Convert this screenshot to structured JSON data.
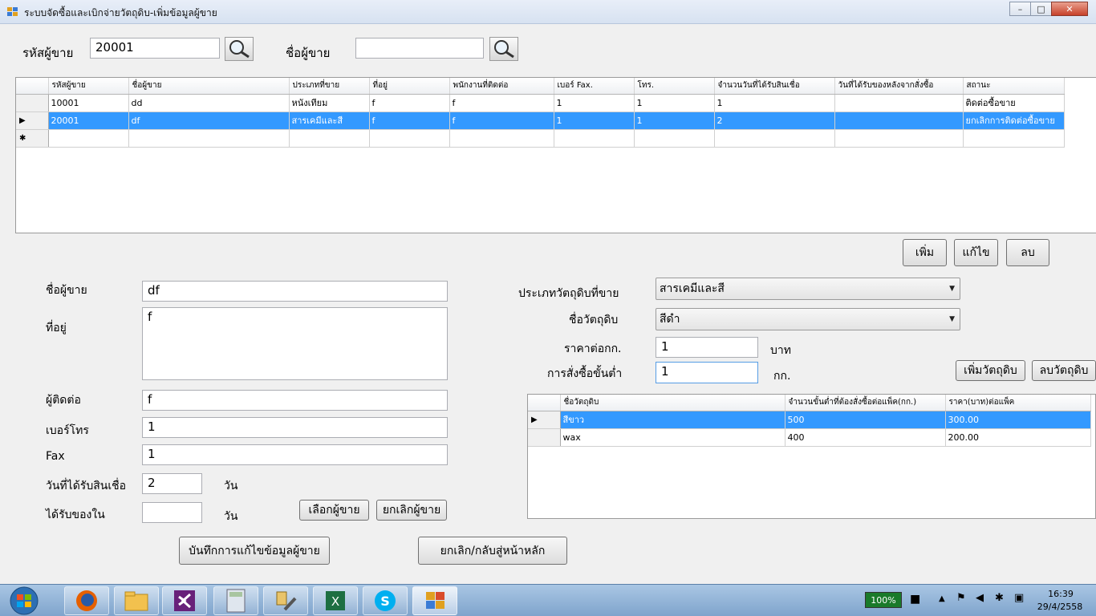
{
  "window": {
    "title": "ระบบจัดซื้อและเบิกจ่ายวัตถุดิบ-เพิ่มข้อมูลผู้ขาย",
    "minimize": "–",
    "maximize": "□",
    "close": "✕"
  },
  "search": {
    "code_label": "รหัสผู้ขาย",
    "code_value": "20001",
    "name_label": "ชื่อผู้ขาย",
    "name_value": ""
  },
  "supplier_grid": {
    "columns": [
      "รหัสผู้ขาย",
      "ชื่อผู้ขาย",
      "ประเภทที่ขาย",
      "ที่อยู่",
      "พนักงานที่ติดต่อ",
      "เบอร์ Fax.",
      "โทร.",
      "จำนวนวันที่ได้รับสินเชื่อ",
      "วันที่ได้รับของหลังจากสั่งซื้อ",
      "สถานะ"
    ],
    "rows": [
      {
        "marker": "",
        "cells": [
          "10001",
          "dd",
          "หนังเทียม",
          "f",
          "f",
          "1",
          "1",
          "1",
          "",
          "ติดต่อซื้อขาย"
        ]
      },
      {
        "marker": "▶",
        "cells": [
          "20001",
          "df",
          "สารเคมีและสี",
          "f",
          "f",
          "1",
          "1",
          "2",
          "",
          "ยกเลิกการติดต่อซื้อขาย"
        ]
      },
      {
        "marker": "✱",
        "cells": [
          "",
          "",
          "",
          "",
          "",
          "",
          "",
          "",
          "",
          ""
        ]
      }
    ],
    "selected_row": 1
  },
  "actions": {
    "add": "เพิ่ม",
    "edit": "แก้ไข",
    "delete": "ลบ"
  },
  "form": {
    "name_label": "ชื่อผู้ขาย",
    "name_value": "df",
    "address_label": "ที่อยู่",
    "address_value": "f",
    "contact_label": "ผู้ติดต่อ",
    "contact_value": "f",
    "phone_label": "เบอร์โทร",
    "phone_value": "1",
    "fax_label": "Fax",
    "fax_value": "1",
    "credit_label": "วันที่ได้รับสินเชื่อ",
    "credit_value": "2",
    "credit_unit": "วัน",
    "receive_label": "ได้รับของใน",
    "receive_value": "",
    "receive_unit": "วัน",
    "select_supplier": "เลือกผู้ขาย",
    "cancel_supplier": "ยกเลิกผู้ขาย",
    "save": "บันทึกการแก้ไขข้อมูลผู้ขาย",
    "back": "ยกเลิก/กลับสู่หน้าหลัก"
  },
  "material": {
    "type_label": "ประเภทวัตถุดิบที่ขาย",
    "type_value": "สารเคมีและสี",
    "name_label": "ชื่อวัตถุดิบ",
    "name_value": "สีดำ",
    "price_label": "ราคาต่อกก.",
    "price_value": "1",
    "price_unit": "บาท",
    "min_label": "การสั่งซื้อขั้นต่ำ",
    "min_value": "1",
    "min_unit": "กก.",
    "add_btn": "เพิ่มวัตถุดิบ",
    "del_btn": "ลบวัตถุดิบ"
  },
  "material_grid": {
    "columns": [
      "ชื่อวัตถุดิบ",
      "จำนวนขั้นต่ำที่ต้องสั่งซื้อต่อแพ็ค(กก.)",
      "ราคา(บาท)ต่อแพ็ค"
    ],
    "rows": [
      {
        "marker": "▶",
        "cells": [
          "สีขาว",
          "500",
          "300.00"
        ]
      },
      {
        "marker": "",
        "cells": [
          "wax",
          "400",
          "200.00"
        ]
      }
    ]
  },
  "taskbar": {
    "battery": "100%",
    "time": "16:39",
    "date": "29/4/2558"
  },
  "colors": {
    "selection": "#3399ff",
    "taskbar": "#8fb2d6"
  }
}
